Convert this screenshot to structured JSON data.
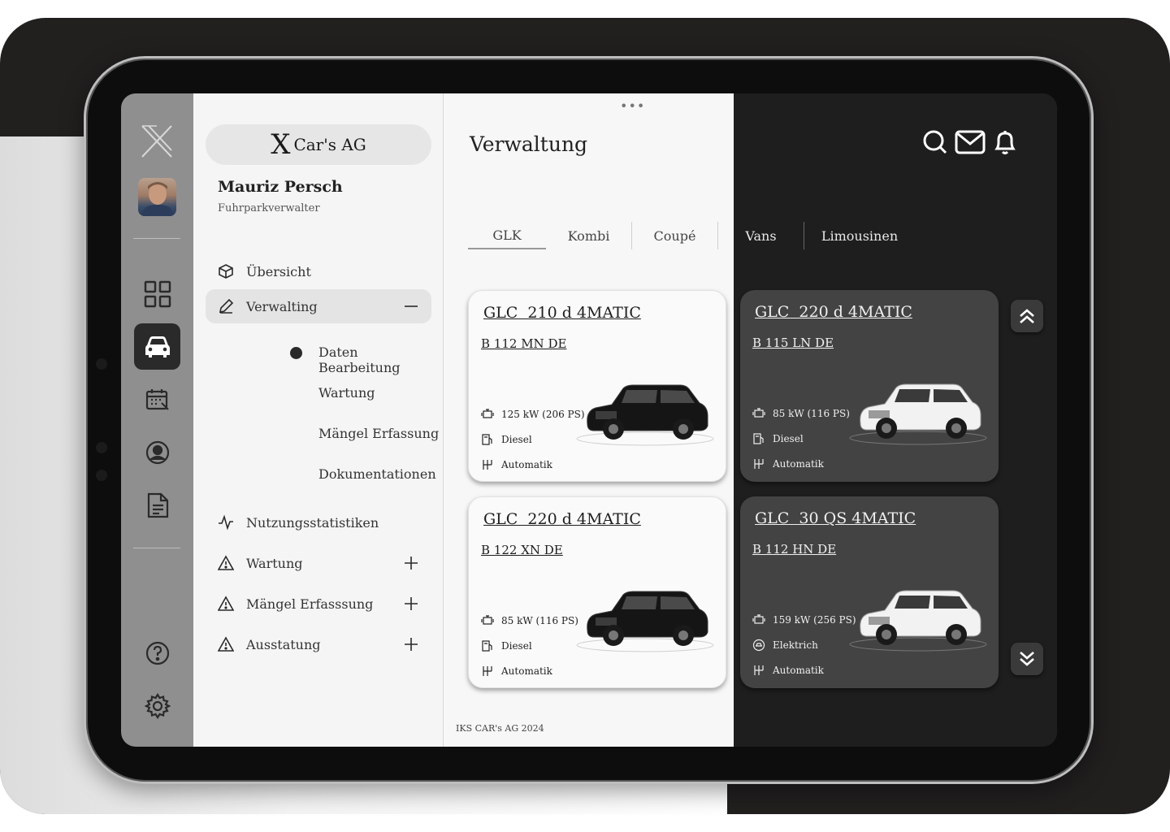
{
  "brand": {
    "x": "X",
    "name": "Car's AG"
  },
  "user": {
    "name": "Mauriz Persch",
    "role": "Fuhrparkverwalter"
  },
  "nav": {
    "overview": "Übersicht",
    "admin": "Verwalting",
    "sub": [
      "Daten Bearbeitung",
      "Wartung",
      "Mängel Erfassung",
      "Dokumentationen"
    ],
    "stats": "Nutzungsstatistiken",
    "maintenance": "Wartung",
    "defects": "Mängel Erfasssung",
    "equipment": "Ausstatung"
  },
  "header": {
    "title": "Verwaltung",
    "dots": "•••"
  },
  "tabs": [
    "GLK",
    "Kombi",
    "Coupé",
    "Vans",
    "Limousinen"
  ],
  "cars": [
    {
      "model": "GLC  210 d 4MATIC",
      "plate": "B 112 MN DE",
      "power": "125 kW (206 PS)",
      "fuel": "Diesel",
      "gear": "Automatik",
      "color": "black",
      "theme": "light"
    },
    {
      "model": "GLC  220 d 4MATIC",
      "plate": "B 115 LN DE",
      "power": "85 kW (116 PS)",
      "fuel": "Diesel",
      "gear": "Automatik",
      "color": "white",
      "theme": "dark"
    },
    {
      "model": "GLC  220 d 4MATIC",
      "plate": "B 122 XN DE",
      "power": "85 kW (116 PS)",
      "fuel": "Diesel",
      "gear": "Automatik",
      "color": "black",
      "theme": "light"
    },
    {
      "model": "GLC  30 QS 4MATIC",
      "plate": "B 112 HN DE",
      "power": "159 kW (256 PS)",
      "fuel": "Elektrich",
      "gear": "Automatik",
      "color": "white",
      "theme": "dark"
    }
  ],
  "footer": "IKS CAR's AG 2024",
  "colors": {
    "rail": "#8f8f8f",
    "dark": "#1e1e1e",
    "card_dark": "#434343",
    "panel": "#f5f5f5"
  }
}
